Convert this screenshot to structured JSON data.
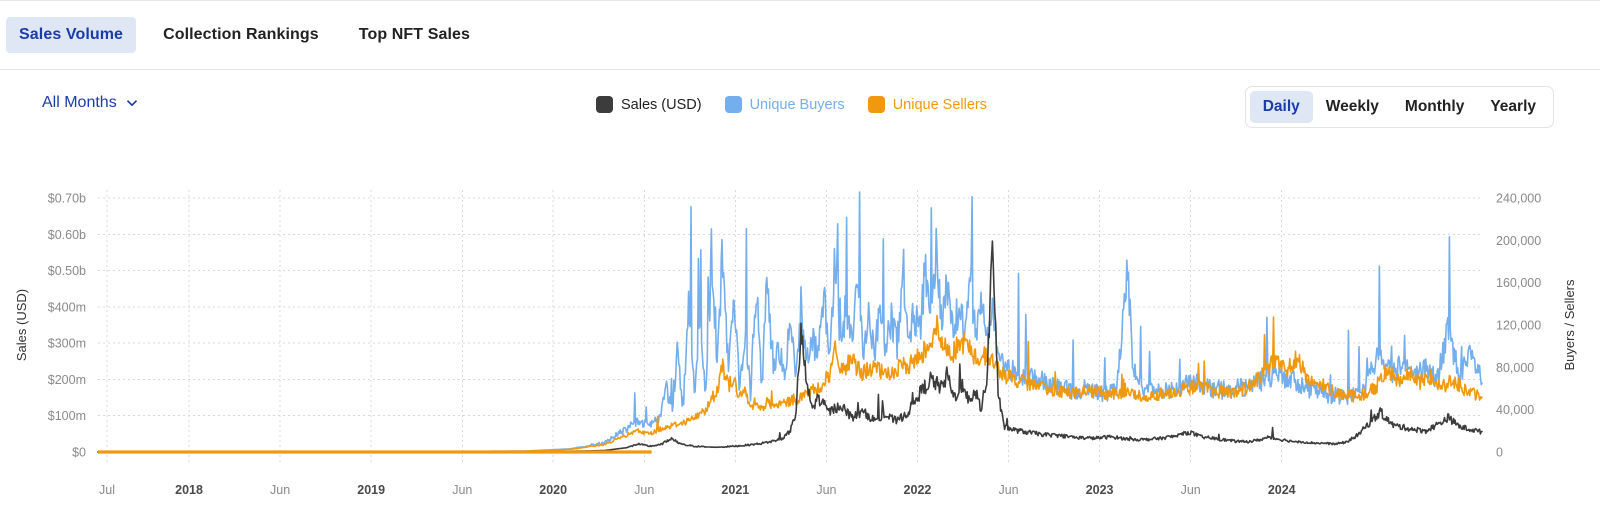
{
  "tabs": [
    {
      "label": "Sales Volume",
      "active": true
    },
    {
      "label": "Collection Rankings",
      "active": false
    },
    {
      "label": "Top NFT Sales",
      "active": false
    }
  ],
  "controls": {
    "months_label": "All Months",
    "months_icon": "chevron-down-icon"
  },
  "periods": [
    {
      "label": "Daily",
      "active": true
    },
    {
      "label": "Weekly",
      "active": false
    },
    {
      "label": "Monthly",
      "active": false
    },
    {
      "label": "Yearly",
      "active": false
    }
  ],
  "colors": {
    "sales": "#3c3c3c",
    "buyers": "#74aeec",
    "sellers": "#f0990f",
    "accent": "#1a3ca8",
    "active_bg": "#dfe6f4",
    "grid": "#d8d8d8",
    "tick_text": "#8a8a8a"
  },
  "chart_data": {
    "type": "line",
    "title": "",
    "xlabel": "",
    "ylabel": "Sales (USD)",
    "y2label": "Buyers / Sellers",
    "grid": true,
    "legend_position": "top-center",
    "ylim": [
      0,
      700000000
    ],
    "y2lim": [
      0,
      240000
    ],
    "yticks": [
      0,
      100000000,
      200000000,
      300000000,
      400000000,
      500000000,
      600000000,
      700000000
    ],
    "ytick_labels": [
      "$0",
      "$100m",
      "$200m",
      "$300m",
      "$400m",
      "$0.50b",
      "$0.60b",
      "$0.70b"
    ],
    "y2ticks": [
      0,
      40000,
      80000,
      120000,
      160000,
      200000,
      240000
    ],
    "y2tick_labels": [
      "0",
      "40,000",
      "80,000",
      "120,000",
      "160,000",
      "200,000",
      "240,000"
    ],
    "xtick_labels": [
      "Jul",
      "2018",
      "Jun",
      "2019",
      "Jun",
      "2020",
      "Jun",
      "2021",
      "Jun",
      "2022",
      "Jun",
      "2023",
      "Jun",
      "2024"
    ],
    "xtick_bold": [
      false,
      true,
      false,
      true,
      false,
      true,
      false,
      true,
      false,
      true,
      false,
      true,
      false,
      true
    ],
    "xtick_positions": [
      0.0065,
      0.0658,
      0.1316,
      0.1974,
      0.2632,
      0.3289,
      0.3947,
      0.4605,
      0.5263,
      0.5921,
      0.6579,
      0.7237,
      0.7895,
      0.8553
    ],
    "x_start_label": "2017-07",
    "x_end_label": "2024-09",
    "series": [
      {
        "name": "Sales (USD)",
        "axis": "left",
        "color": "#3c3c3c",
        "unit": "USD",
        "anchors": [
          [
            0.0,
            0.3
          ],
          [
            0.1,
            0.4
          ],
          [
            0.2,
            0.5
          ],
          [
            0.3,
            0.6
          ],
          [
            0.38,
            1.0
          ],
          [
            0.42,
            2.0
          ],
          [
            0.45,
            4.0
          ],
          [
            0.47,
            12.0
          ],
          [
            0.48,
            22.0
          ],
          [
            0.49,
            16.0
          ],
          [
            0.5,
            20.0
          ],
          [
            0.51,
            38.0
          ],
          [
            0.515,
            26.0
          ],
          [
            0.52,
            20.0
          ],
          [
            0.53,
            16.0
          ],
          [
            0.54,
            14.0
          ],
          [
            0.55,
            13.0
          ],
          [
            0.56,
            15.0
          ],
          [
            0.57,
            17.0
          ],
          [
            0.58,
            20.0
          ],
          [
            0.59,
            24.0
          ],
          [
            0.6,
            30.0
          ],
          [
            0.61,
            40.0
          ],
          [
            0.615,
            58.0
          ],
          [
            0.62,
            100.0
          ],
          [
            0.625,
            330.0
          ],
          [
            0.63,
            180.0
          ],
          [
            0.635,
            120.0
          ],
          [
            0.64,
            150.0
          ],
          [
            0.65,
            110.0
          ],
          [
            0.66,
            130.0
          ],
          [
            0.67,
            95.0
          ],
          [
            0.68,
            110.0
          ],
          [
            0.69,
            88.0
          ],
          [
            0.7,
            100.0
          ],
          [
            0.71,
            85.0
          ],
          [
            0.72,
            110.0
          ],
          [
            0.73,
            160.0
          ],
          [
            0.74,
            200.0
          ],
          [
            0.75,
            175.0
          ],
          [
            0.755,
            215.0
          ],
          [
            0.76,
            150.0
          ],
          [
            0.77,
            185.0
          ],
          [
            0.775,
            130.0
          ],
          [
            0.78,
            165.0
          ],
          [
            0.785,
            120.0
          ],
          [
            0.79,
            200.0
          ],
          [
            0.795,
            580.0
          ],
          [
            0.8,
            160.0
          ],
          [
            0.805,
            70.0
          ],
          [
            0.815,
            60.0
          ],
          [
            0.825,
            55.0
          ],
          [
            0.84,
            48.0
          ],
          [
            0.855,
            45.0
          ],
          [
            0.87,
            40.0
          ],
          [
            0.885,
            38.0
          ],
          [
            0.9,
            42.0
          ],
          [
            0.915,
            36.0
          ],
          [
            0.93,
            34.0
          ],
          [
            0.945,
            38.0
          ],
          [
            0.96,
            45.0
          ],
          [
            0.97,
            55.0
          ],
          [
            0.98,
            42.0
          ],
          [
            0.99,
            38.0
          ],
          [
            1.0,
            34.0
          ],
          [
            1.01,
            30.0
          ],
          [
            1.02,
            28.0
          ],
          [
            1.03,
            32.0
          ],
          [
            1.04,
            40.0
          ],
          [
            1.05,
            35.0
          ],
          [
            1.06,
            30.0
          ],
          [
            1.07,
            28.0
          ],
          [
            1.08,
            25.0
          ],
          [
            1.09,
            24.0
          ],
          [
            1.1,
            22.0
          ],
          [
            1.11,
            28.0
          ],
          [
            1.12,
            48.0
          ],
          [
            1.13,
            80.0
          ],
          [
            1.14,
            110.0
          ],
          [
            1.15,
            75.0
          ],
          [
            1.16,
            68.0
          ],
          [
            1.17,
            62.0
          ],
          [
            1.18,
            58.0
          ],
          [
            1.19,
            75.0
          ],
          [
            1.2,
            95.0
          ],
          [
            1.21,
            70.0
          ],
          [
            1.22,
            62.0
          ],
          [
            1.23,
            55.0
          ]
        ],
        "scale_hint": "values in millions USD",
        "peak_value": 580,
        "peak_label": "$0.58b"
      },
      {
        "name": "Unique Buyers",
        "axis": "right",
        "color": "#74aeec",
        "unit": "count",
        "anchors": [
          [
            0.0,
            80
          ],
          [
            0.1,
            120
          ],
          [
            0.2,
            200
          ],
          [
            0.3,
            400
          ],
          [
            0.38,
            900
          ],
          [
            0.42,
            3000
          ],
          [
            0.45,
            9000
          ],
          [
            0.47,
            22000
          ],
          [
            0.48,
            30000
          ],
          [
            0.49,
            24000
          ],
          [
            0.5,
            34000
          ],
          [
            0.505,
            60000
          ],
          [
            0.51,
            38000
          ],
          [
            0.515,
            95000
          ],
          [
            0.52,
            40000
          ],
          [
            0.525,
            150000
          ],
          [
            0.53,
            52000
          ],
          [
            0.535,
            120000
          ],
          [
            0.54,
            58000
          ],
          [
            0.545,
            175000
          ],
          [
            0.55,
            70000
          ],
          [
            0.555,
            200000
          ],
          [
            0.56,
            80000
          ],
          [
            0.565,
            150000
          ],
          [
            0.57,
            62000
          ],
          [
            0.575,
            110000
          ],
          [
            0.58,
            55000
          ],
          [
            0.585,
            165000
          ],
          [
            0.59,
            60000
          ],
          [
            0.595,
            170000
          ],
          [
            0.6,
            65000
          ],
          [
            0.605,
            100000
          ],
          [
            0.61,
            70000
          ],
          [
            0.615,
            120000
          ],
          [
            0.62,
            75000
          ],
          [
            0.625,
            140000
          ],
          [
            0.63,
            85000
          ],
          [
            0.635,
            110000
          ],
          [
            0.64,
            90000
          ],
          [
            0.645,
            150000
          ],
          [
            0.65,
            95000
          ],
          [
            0.655,
            185000
          ],
          [
            0.66,
            100000
          ],
          [
            0.665,
            140000
          ],
          [
            0.67,
            105000
          ],
          [
            0.675,
            160000
          ],
          [
            0.68,
            98000
          ],
          [
            0.685,
            130000
          ],
          [
            0.69,
            92000
          ],
          [
            0.695,
            145000
          ],
          [
            0.7,
            96000
          ],
          [
            0.705,
            125000
          ],
          [
            0.71,
            100000
          ],
          [
            0.715,
            155000
          ],
          [
            0.72,
            105000
          ],
          [
            0.725,
            135000
          ],
          [
            0.73,
            110000
          ],
          [
            0.735,
            170000
          ],
          [
            0.74,
            115000
          ],
          [
            0.745,
            185000
          ],
          [
            0.75,
            120000
          ],
          [
            0.755,
            160000
          ],
          [
            0.76,
            112000
          ],
          [
            0.765,
            140000
          ],
          [
            0.77,
            108000
          ],
          [
            0.775,
            175000
          ],
          [
            0.78,
            105000
          ],
          [
            0.785,
            150000
          ],
          [
            0.79,
            100000
          ],
          [
            0.795,
            130000
          ],
          [
            0.8,
            90000
          ],
          [
            0.81,
            80000
          ],
          [
            0.82,
            72000
          ],
          [
            0.835,
            68000
          ],
          [
            0.85,
            62000
          ],
          [
            0.865,
            58000
          ],
          [
            0.88,
            60000
          ],
          [
            0.895,
            55000
          ],
          [
            0.905,
            58000
          ],
          [
            0.915,
            170000
          ],
          [
            0.92,
            75000
          ],
          [
            0.93,
            60000
          ],
          [
            0.945,
            58000
          ],
          [
            0.96,
            62000
          ],
          [
            0.975,
            66000
          ],
          [
            0.99,
            60000
          ],
          [
            1.005,
            58000
          ],
          [
            1.02,
            62000
          ],
          [
            1.035,
            68000
          ],
          [
            1.05,
            72000
          ],
          [
            1.065,
            66000
          ],
          [
            1.08,
            58000
          ],
          [
            1.095,
            54000
          ],
          [
            1.11,
            52000
          ],
          [
            1.125,
            60000
          ],
          [
            1.14,
            95000
          ],
          [
            1.15,
            75000
          ],
          [
            1.16,
            88000
          ],
          [
            1.17,
            70000
          ],
          [
            1.18,
            80000
          ],
          [
            1.19,
            68000
          ],
          [
            1.2,
            115000
          ],
          [
            1.21,
            72000
          ],
          [
            1.22,
            90000
          ],
          [
            1.23,
            68000
          ]
        ],
        "peak_value": 200000
      },
      {
        "name": "Unique Sellers",
        "axis": "right",
        "color": "#f0990f",
        "unit": "count",
        "anchors": [
          [
            0.0,
            60
          ],
          [
            0.1,
            90
          ],
          [
            0.2,
            160
          ],
          [
            0.3,
            320
          ],
          [
            0.38,
            700
          ],
          [
            0.42,
            2500
          ],
          [
            0.45,
            7000
          ],
          [
            0.47,
            16000
          ],
          [
            0.48,
            20000
          ],
          [
            0.49,
            17000
          ],
          [
            0.5,
            22000
          ],
          [
            0.51,
            25000
          ],
          [
            0.52,
            28000
          ],
          [
            0.53,
            32000
          ],
          [
            0.54,
            40000
          ],
          [
            0.55,
            58000
          ],
          [
            0.555,
            85000
          ],
          [
            0.56,
            62000
          ],
          [
            0.565,
            70000
          ],
          [
            0.57,
            50000
          ],
          [
            0.575,
            58000
          ],
          [
            0.58,
            42000
          ],
          [
            0.585,
            50000
          ],
          [
            0.59,
            40000
          ],
          [
            0.595,
            48000
          ],
          [
            0.6,
            42000
          ],
          [
            0.61,
            46000
          ],
          [
            0.62,
            50000
          ],
          [
            0.63,
            55000
          ],
          [
            0.64,
            60000
          ],
          [
            0.65,
            72000
          ],
          [
            0.655,
            95000
          ],
          [
            0.66,
            78000
          ],
          [
            0.67,
            85000
          ],
          [
            0.68,
            75000
          ],
          [
            0.69,
            80000
          ],
          [
            0.7,
            72000
          ],
          [
            0.71,
            78000
          ],
          [
            0.72,
            82000
          ],
          [
            0.73,
            90000
          ],
          [
            0.74,
            105000
          ],
          [
            0.745,
            120000
          ],
          [
            0.75,
            100000
          ],
          [
            0.76,
            95000
          ],
          [
            0.77,
            105000
          ],
          [
            0.78,
            88000
          ],
          [
            0.79,
            92000
          ],
          [
            0.8,
            78000
          ],
          [
            0.81,
            70000
          ],
          [
            0.825,
            65000
          ],
          [
            0.84,
            60000
          ],
          [
            0.855,
            58000
          ],
          [
            0.87,
            56000
          ],
          [
            0.885,
            58000
          ],
          [
            0.9,
            54000
          ],
          [
            0.915,
            56000
          ],
          [
            0.93,
            52000
          ],
          [
            0.945,
            55000
          ],
          [
            0.96,
            58000
          ],
          [
            0.975,
            62000
          ],
          [
            0.99,
            58000
          ],
          [
            1.005,
            56000
          ],
          [
            1.02,
            60000
          ],
          [
            1.035,
            72000
          ],
          [
            1.045,
            85000
          ],
          [
            1.055,
            78000
          ],
          [
            1.065,
            88000
          ],
          [
            1.075,
            70000
          ],
          [
            1.09,
            62000
          ],
          [
            1.105,
            55000
          ],
          [
            1.12,
            52000
          ],
          [
            1.135,
            60000
          ],
          [
            1.145,
            78000
          ],
          [
            1.155,
            68000
          ],
          [
            1.165,
            75000
          ],
          [
            1.175,
            65000
          ],
          [
            1.185,
            72000
          ],
          [
            1.195,
            62000
          ],
          [
            1.205,
            68000
          ],
          [
            1.215,
            58000
          ],
          [
            1.23,
            52000
          ]
        ],
        "peak_value": 120000
      }
    ]
  }
}
